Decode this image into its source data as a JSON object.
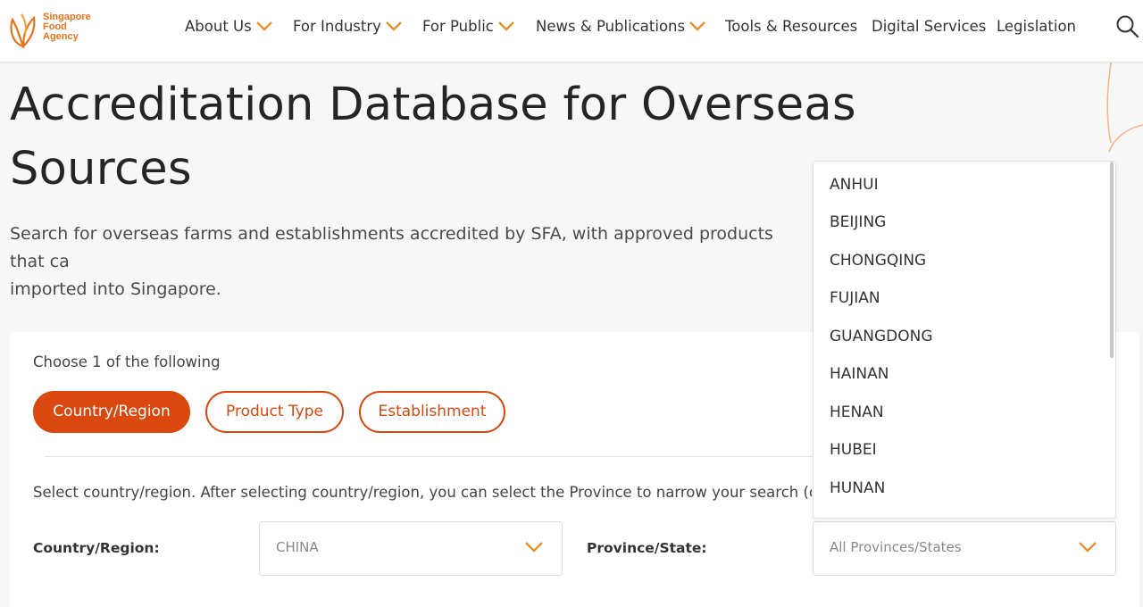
{
  "brand": {
    "logo_lines": [
      "Singapore",
      "Food",
      "Agency"
    ],
    "color": "#e8731c"
  },
  "nav": {
    "items": [
      {
        "label": "About Us",
        "has_menu": true
      },
      {
        "label": "For Industry",
        "has_menu": true
      },
      {
        "label": "For Public",
        "has_menu": true
      },
      {
        "label": "News & Publications",
        "has_menu": true
      },
      {
        "label": "Tools & Resources",
        "has_menu": false
      },
      {
        "label": "Digital Services",
        "has_menu": false
      },
      {
        "label": "Legislation",
        "has_menu": false
      }
    ],
    "search_icon": "search-icon"
  },
  "page": {
    "title_line1": "Accreditation Database for Overseas",
    "title_line2": "Sources",
    "intro_line1": "Search for overseas farms and establishments accredited by SFA, with approved products that ca",
    "intro_line2": "imported into Singapore."
  },
  "search": {
    "choose_label": "Choose 1 of the following",
    "tabs": [
      {
        "label": "Country/Region",
        "active": true
      },
      {
        "label": "Product Type",
        "active": false
      },
      {
        "label": "Establishment",
        "active": false
      }
    ],
    "hint": "Select country/region. After selecting country/region, you can select the Province to narrow your search (o",
    "country_label": "Country/Region:",
    "country_value": "CHINA",
    "province_label": "Province/State:",
    "province_value": "All Provinces/States"
  },
  "province_dropdown": {
    "options": [
      "ANHUI",
      "BEIJING",
      "CHONGQING",
      "FUJIAN",
      "GUANGDONG",
      "HAINAN",
      "HENAN",
      "HUBEI",
      "HUNAN"
    ]
  },
  "colors": {
    "accent": "#d9480f",
    "chevron": "#e8912d"
  }
}
